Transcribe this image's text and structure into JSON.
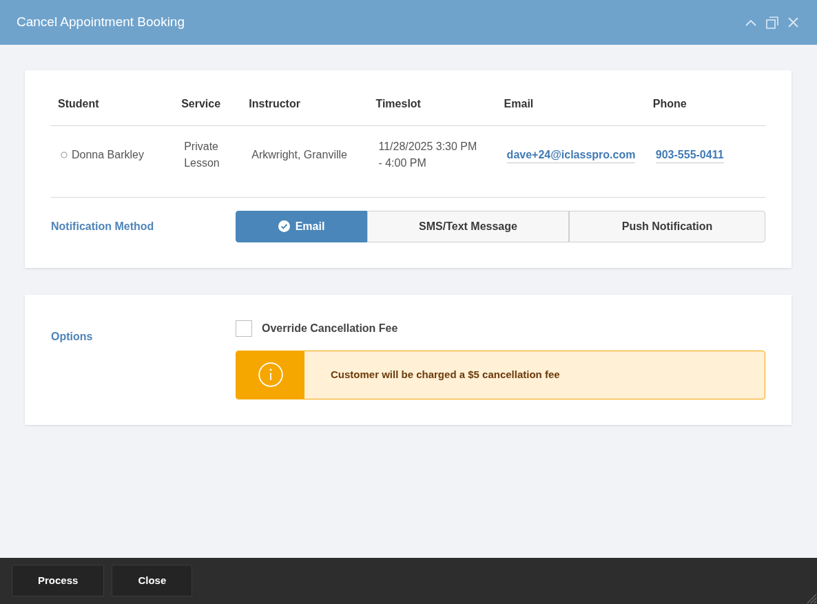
{
  "window": {
    "title": "Cancel Appointment Booking"
  },
  "booking": {
    "columns": [
      "Student",
      "Service",
      "Instructor",
      "Timeslot",
      "Email",
      "Phone"
    ],
    "rows": [
      {
        "student": "Donna Barkley",
        "service": "Private Lesson",
        "instructor": "Arkwright, Granville",
        "timeslot": "11/28/2025 3:30 PM - 4:00 PM",
        "email": "dave+24@iclasspro.com",
        "phone": "903-555-0411"
      }
    ]
  },
  "notification_method": {
    "label": "Notification Method",
    "options": [
      {
        "label": "Email",
        "selected": true
      },
      {
        "label": "SMS/Text Message",
        "selected": false
      },
      {
        "label": "Push Notification",
        "selected": false
      }
    ]
  },
  "options": {
    "label": "Options",
    "override_fee": {
      "label": "Override Cancellation Fee",
      "checked": false
    },
    "alert": {
      "text": "Customer will be charged a $5 cancellation fee"
    }
  },
  "footer": {
    "buttons": [
      "Process",
      "Close"
    ]
  }
}
